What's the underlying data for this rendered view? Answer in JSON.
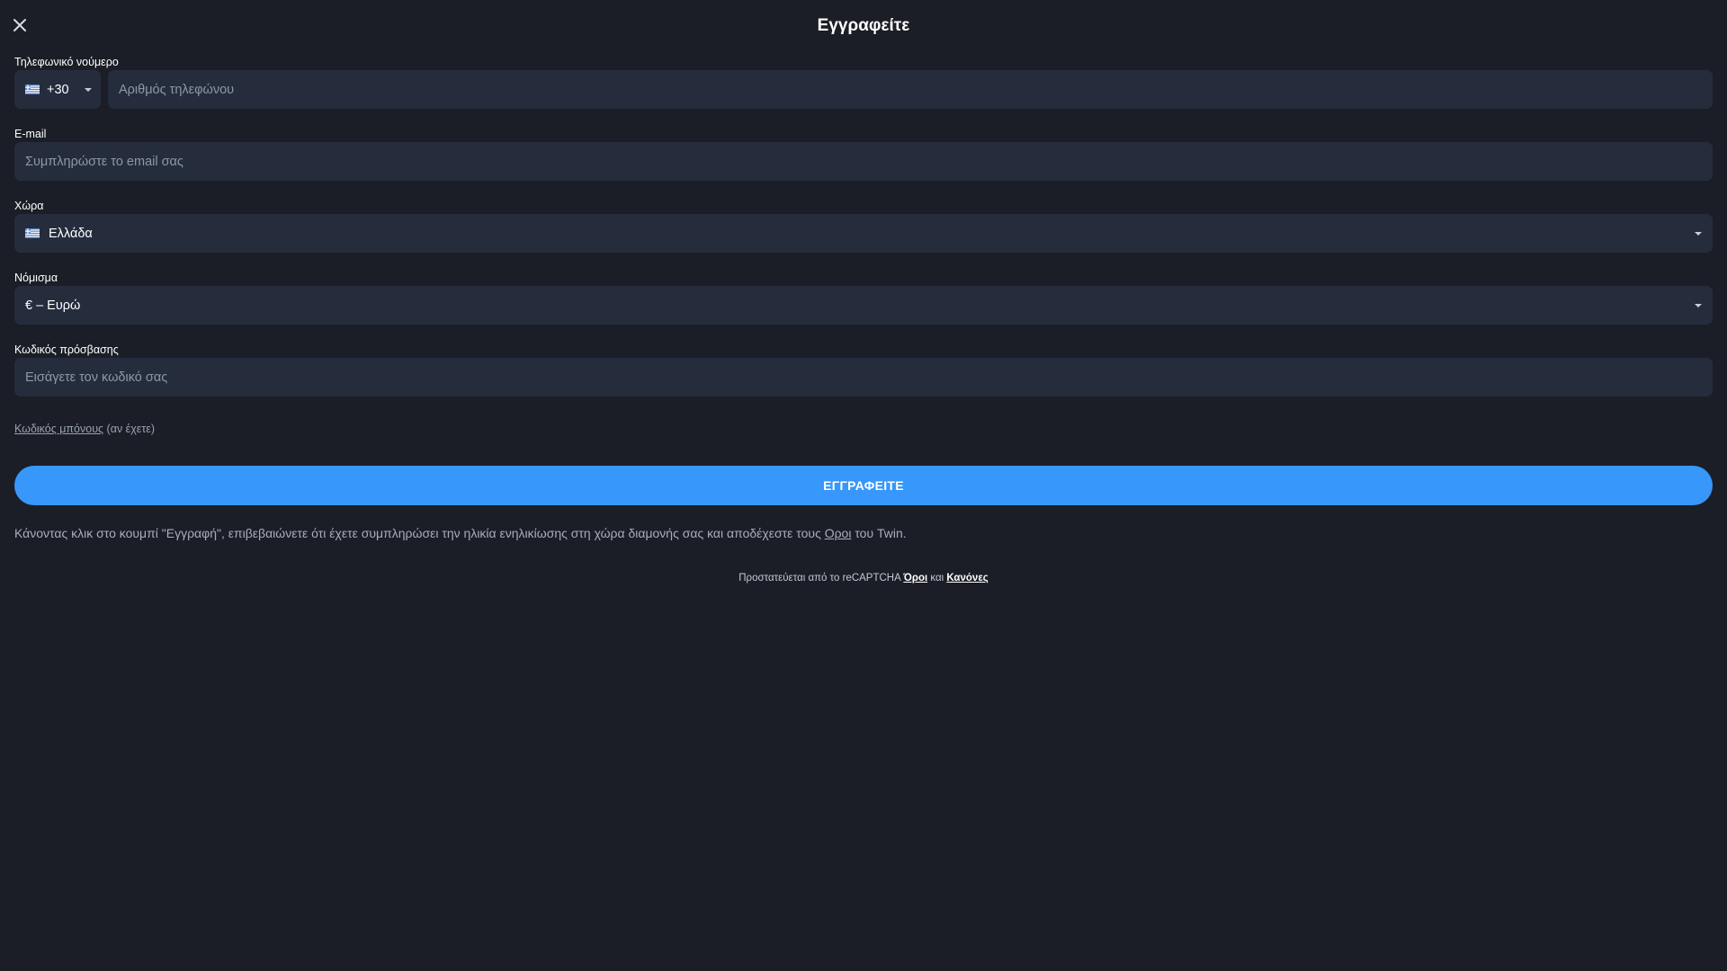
{
  "header": {
    "title": "Εγγραφείτε"
  },
  "phone": {
    "label": "Τηλεφωνικό νούμερο",
    "country_code": "+30",
    "placeholder": "Αριθμός τηλεφώνου"
  },
  "email": {
    "label": "E-mail",
    "placeholder": "Συμπληρώστε το email σας"
  },
  "country": {
    "label": "Χώρα",
    "value": "Ελλάδα"
  },
  "currency": {
    "label": "Νόμισμα",
    "value": "€ – Ευρώ"
  },
  "password": {
    "label": "Κωδικός πρόσβασης",
    "placeholder": "Εισάγετε τον κωδικό σας"
  },
  "bonus": {
    "link_text": "Κωδικός μπόνους",
    "suffix": " (αν έχετε)"
  },
  "submit": {
    "label": "ΕΓΓΡΑΦΕΙΤΕ"
  },
  "disclaimer": {
    "text_before": "Κάνοντας κλικ στο κουμπί \"Εγγραφή\", επιβεβαιώνετε ότι έχετε συμπληρώσει την ηλικία ενηλικίωσης στη χώρα διαμονής σας και αποδέχεστε τους ",
    "link_text": "Οροι",
    "text_after": " του Twin."
  },
  "recaptcha": {
    "text_before": "Προστατεύεται από το reCAPTCHA ",
    "terms_link": "Όροι",
    "middle": " και ",
    "rules_link": "Κανόνες"
  },
  "colors": {
    "background": "#1b1e26",
    "field": "#252d3d",
    "accent": "#3897fb"
  },
  "icons": {
    "close": "close-icon",
    "flag": "greece-flag-icon",
    "dropdown": "caret-down-icon"
  }
}
